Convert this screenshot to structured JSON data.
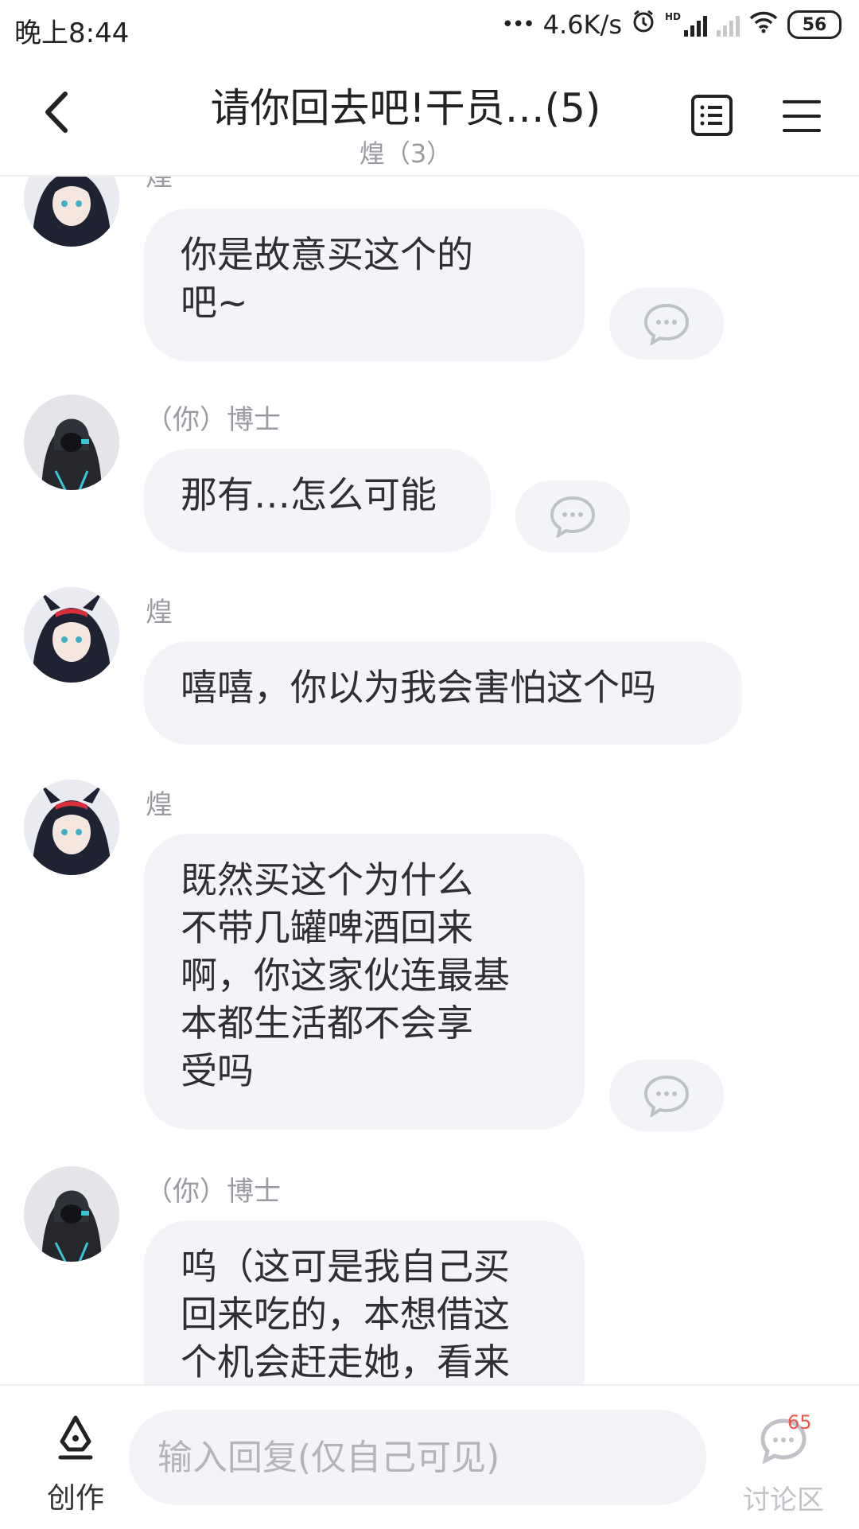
{
  "status_bar": {
    "time": "晚上8:44",
    "network_speed": "4.6K/s",
    "network_type": "HD",
    "battery": "56"
  },
  "header": {
    "title": "请你回去吧!干员…(5)",
    "subtitle": "煌（3）"
  },
  "messages": [
    {
      "sender": "煌",
      "avatar": "huang",
      "text": "你是故意买这个的\n吧~",
      "has_comment_button": true
    },
    {
      "sender": "（你）博士",
      "avatar": "doctor",
      "text": "那有…怎么可能",
      "has_comment_button": true
    },
    {
      "sender": "煌",
      "avatar": "huang",
      "text": "嘻嘻，你以为我会害怕这个吗",
      "has_comment_button": false
    },
    {
      "sender": "煌",
      "avatar": "huang",
      "text": "既然买这个为什么\n不带几罐啤酒回来\n啊，你这家伙连最基\n本都生活都不会享\n受吗",
      "has_comment_button": true
    },
    {
      "sender": "（你）博士",
      "avatar": "doctor",
      "text": "呜（这可是我自己买\n回来吃的，本想借这\n个机会赶走她，看来",
      "has_comment_button": false
    }
  ],
  "bottom_bar": {
    "create_label": "创作",
    "reply_placeholder": "输入回复(仅自己可见)",
    "discuss_label": "讨论区",
    "discuss_count": "65"
  },
  "colors": {
    "bubble_bg": "#f3f4f8",
    "text_primary": "#2e2e33",
    "text_secondary": "#9a9aa2",
    "badge": "#f0554a"
  },
  "icons": {
    "back": "chevron-left-icon",
    "chapter_list": "list-icon",
    "menu": "hamburger-icon",
    "comment": "comment-bubble-icon",
    "create": "pen-nib-icon",
    "discuss": "discussion-icon"
  }
}
